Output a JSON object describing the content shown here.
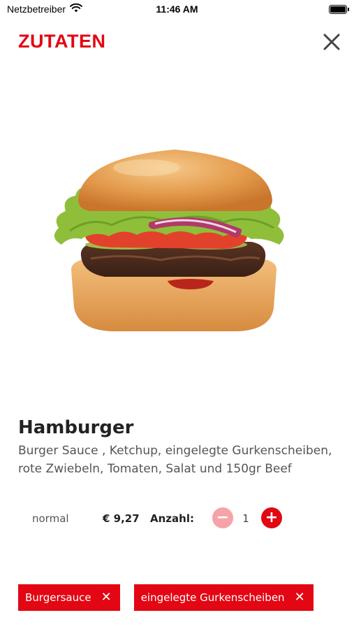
{
  "status_bar": {
    "carrier": "Netzbetreiber",
    "time": "11:46 AM"
  },
  "header": {
    "title": "ZUTATEN",
    "close_icon": "close-icon"
  },
  "product": {
    "name": "Hamburger",
    "description": "Burger Sauce , Ketchup, eingelegte Gurkenscheiben, rote Zwiebeln, Tomaten, Salat und 150gr Beef",
    "size": "normal",
    "price": "€ 9,27",
    "quantity_label": "Anzahl:",
    "quantity": "1",
    "minus_symbol": "−",
    "plus_symbol": "+"
  },
  "tags": [
    {
      "label": "Burgersauce",
      "remove_symbol": "✕"
    },
    {
      "label": "eingelegte Gurkenscheiben",
      "remove_symbol": "✕"
    }
  ],
  "colors": {
    "accent": "#e30613",
    "accent_disabled": "#f5a3a8",
    "text_dark": "#222222",
    "text_muted": "#555555"
  }
}
